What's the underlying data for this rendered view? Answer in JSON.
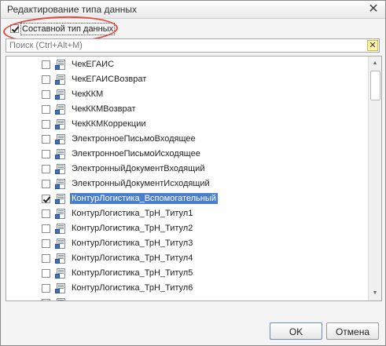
{
  "window": {
    "title": "Редактирование типа данных",
    "close_label": "✕"
  },
  "composite": {
    "label": "Составной тип данных",
    "checked": true
  },
  "search": {
    "placeholder": "Поиск (Ctrl+Alt+M)",
    "value": "",
    "clear_label": "✕"
  },
  "list": {
    "items": [
      {
        "label": "ЧекЕГАИС",
        "checked": false,
        "selected": false
      },
      {
        "label": "ЧекЕГАИСВозврат",
        "checked": false,
        "selected": false
      },
      {
        "label": "ЧекККМ",
        "checked": false,
        "selected": false
      },
      {
        "label": "ЧекККМВозврат",
        "checked": false,
        "selected": false
      },
      {
        "label": "ЧекККМКоррекции",
        "checked": false,
        "selected": false
      },
      {
        "label": "ЭлектронноеПисьмоВходящее",
        "checked": false,
        "selected": false
      },
      {
        "label": "ЭлектронноеПисьмоИсходящее",
        "checked": false,
        "selected": false
      },
      {
        "label": "ЭлектронныйДокументВходящий",
        "checked": false,
        "selected": false
      },
      {
        "label": "ЭлектронныйДокументИсходящий",
        "checked": false,
        "selected": false
      },
      {
        "label": "КонтурЛогистика_Вспомогательный",
        "checked": true,
        "selected": true
      },
      {
        "label": "КонтурЛогистика_ТрН_Титул1",
        "checked": false,
        "selected": false
      },
      {
        "label": "КонтурЛогистика_ТрН_Титул2",
        "checked": false,
        "selected": false
      },
      {
        "label": "КонтурЛогистика_ТрН_Титул3",
        "checked": false,
        "selected": false
      },
      {
        "label": "КонтурЛогистика_ТрН_Титул4",
        "checked": false,
        "selected": false
      },
      {
        "label": "КонтурЛогистика_ТрН_Титул5",
        "checked": false,
        "selected": false
      },
      {
        "label": "КонтурЛогистика_ТрН_Титул6",
        "checked": false,
        "selected": false
      },
      {
        "label": "",
        "checked": false,
        "selected": false
      }
    ]
  },
  "buttons": {
    "ok_label": "OK",
    "cancel_label": "Отмена"
  },
  "colors": {
    "selection": "#4a7fd0",
    "annotation_circle": "#e24a3f"
  }
}
